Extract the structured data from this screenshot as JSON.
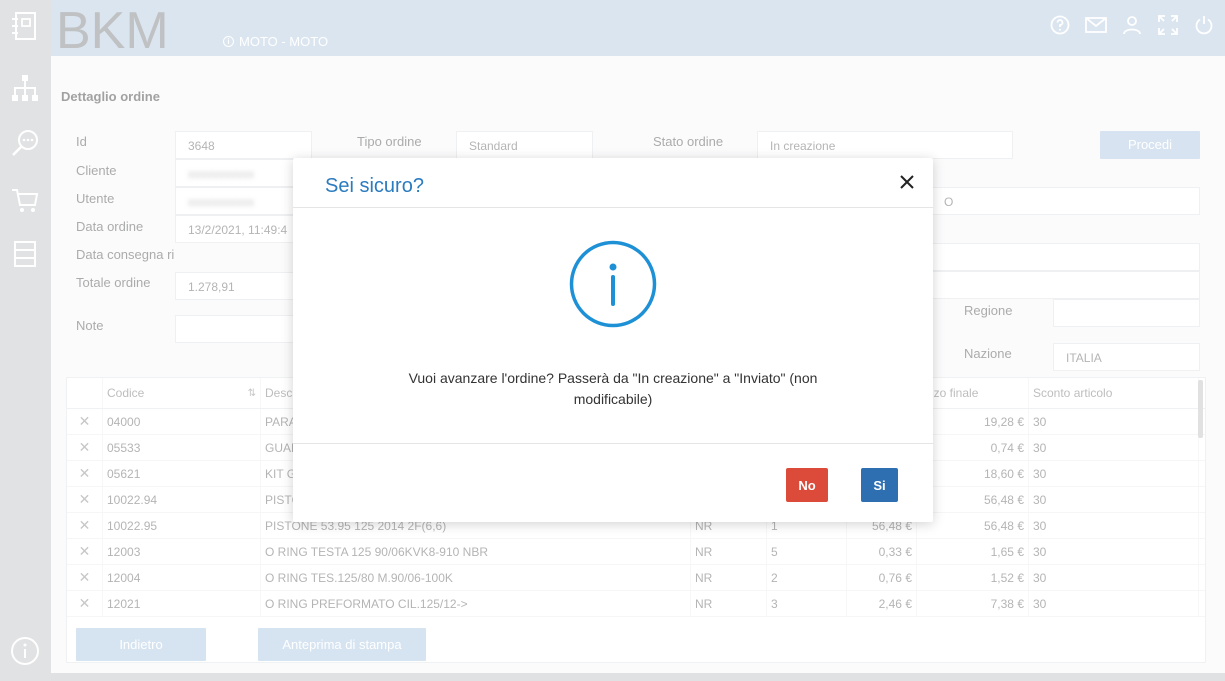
{
  "header": {
    "logo_text": "BKM",
    "env_label": "MOTO - MOTO"
  },
  "page": {
    "section_title": "Dettaglio ordine"
  },
  "fields": {
    "id_label": "Id",
    "id_value": "3648",
    "tipo_label": "Tipo ordine",
    "tipo_value": "Standard",
    "stato_label": "Stato ordine",
    "stato_value": "In creazione",
    "cliente_label": "Cliente",
    "cliente_value": "xxxxxxxxxxx",
    "utente_label": "Utente",
    "utente_value": "xxxxxxxxxxx",
    "data_label": "Data ordine",
    "data_value": "13/2/2021, 11:49:4",
    "consegna_label": "Data consegna ri",
    "totale_label": "Totale ordine",
    "totale_value": "1.278,91",
    "note_label": "Note",
    "regione_label": "Regione",
    "nazione_label": "Nazione",
    "nazione_value": "ITALIA",
    "partial_o": "O"
  },
  "buttons": {
    "procedi": "Procedi",
    "indietro": "Indietro",
    "anteprima": "Anteprima di stampa"
  },
  "table": {
    "headers": {
      "codice": "Codice",
      "descr": "Descri",
      "prezzo_finale": "ezzo finale",
      "sconto": "Sconto articolo"
    },
    "rows": [
      {
        "code": "04000",
        "desc": "PARA",
        "um": "",
        "qty": "",
        "price": "",
        "final": "19,28 €",
        "disc": "30"
      },
      {
        "code": "05533",
        "desc": "GUAR",
        "um": "",
        "qty": "",
        "price": "",
        "final": "0,74 €",
        "disc": "30"
      },
      {
        "code": "05621",
        "desc": "KIT G",
        "um": "",
        "qty": "",
        "price": "",
        "final": "18,60 €",
        "disc": "30"
      },
      {
        "code": "10022.94",
        "desc": "PISTC",
        "um": "",
        "qty": "",
        "price": "",
        "final": "56,48 €",
        "disc": "30"
      },
      {
        "code": "10022.95",
        "desc": "PISTONE 53.95 125 2014 2F(6,6)",
        "um": "NR",
        "qty": "1",
        "price": "56,48 €",
        "final": "56,48 €",
        "disc": "30"
      },
      {
        "code": "12003",
        "desc": "O RING TESTA 125 90/06KVK8-910 NBR",
        "um": "NR",
        "qty": "5",
        "price": "0,33 €",
        "final": "1,65 €",
        "disc": "30"
      },
      {
        "code": "12004",
        "desc": "O RING TES.125/80 M.90/06-100K",
        "um": "NR",
        "qty": "2",
        "price": "0,76 €",
        "final": "1,52 €",
        "disc": "30"
      },
      {
        "code": "12021",
        "desc": "O RING PREFORMATO CIL.125/12->",
        "um": "NR",
        "qty": "3",
        "price": "2,46 €",
        "final": "7,38 €",
        "disc": "30"
      }
    ]
  },
  "modal": {
    "title": "Sei sicuro?",
    "message": "Vuoi avanzare l'ordine? Passerà da \"In creazione\" a \"Inviato\" (non modificabile)",
    "no_label": "No",
    "si_label": "Si"
  },
  "colors": {
    "header_bg": "#bdd0e4",
    "accent": "#2b7bbf",
    "danger": "#dc4b3a",
    "primary": "#2d6fb0"
  }
}
